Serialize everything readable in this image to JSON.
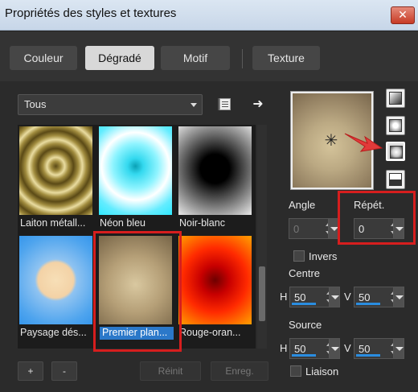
{
  "window": {
    "title": "Propriétés des styles et textures",
    "close_label": "✕"
  },
  "tabs": [
    {
      "label": "Couleur"
    },
    {
      "label": "Dégradé"
    },
    {
      "label": "Motif"
    },
    {
      "label": "Texture"
    }
  ],
  "category": {
    "selected": "Tous"
  },
  "gradients": [
    {
      "label": "Laiton métall..."
    },
    {
      "label": "Néon bleu"
    },
    {
      "label": "Noir-blanc"
    },
    {
      "label": "Paysage dés..."
    },
    {
      "label": "Premier plan..."
    },
    {
      "label": "Rouge-oran..."
    }
  ],
  "buttons": {
    "add": "+",
    "remove": "-",
    "reset": "Réinit",
    "save": "Enreg."
  },
  "angle": {
    "label": "Angle",
    "value": "0"
  },
  "repeat": {
    "label": "Répét.",
    "value": "0"
  },
  "invert": {
    "label": "Invers",
    "checked": false
  },
  "center": {
    "label": "Centre",
    "h_label": "H",
    "h_value": "50",
    "v_label": "V",
    "v_value": "50"
  },
  "source": {
    "label": "Source",
    "h_label": "H",
    "h_value": "50",
    "v_label": "V",
    "v_value": "50"
  },
  "link": {
    "label": "Liaison",
    "checked": false
  },
  "icons": {
    "book": "book-icon",
    "arrow": "arrow-right-icon",
    "preview_center": "crosshair-star-icon",
    "pointer": "red-arrow-icon"
  },
  "colors": {
    "accent": "#2b78c9",
    "highlight": "#d61e1e"
  }
}
